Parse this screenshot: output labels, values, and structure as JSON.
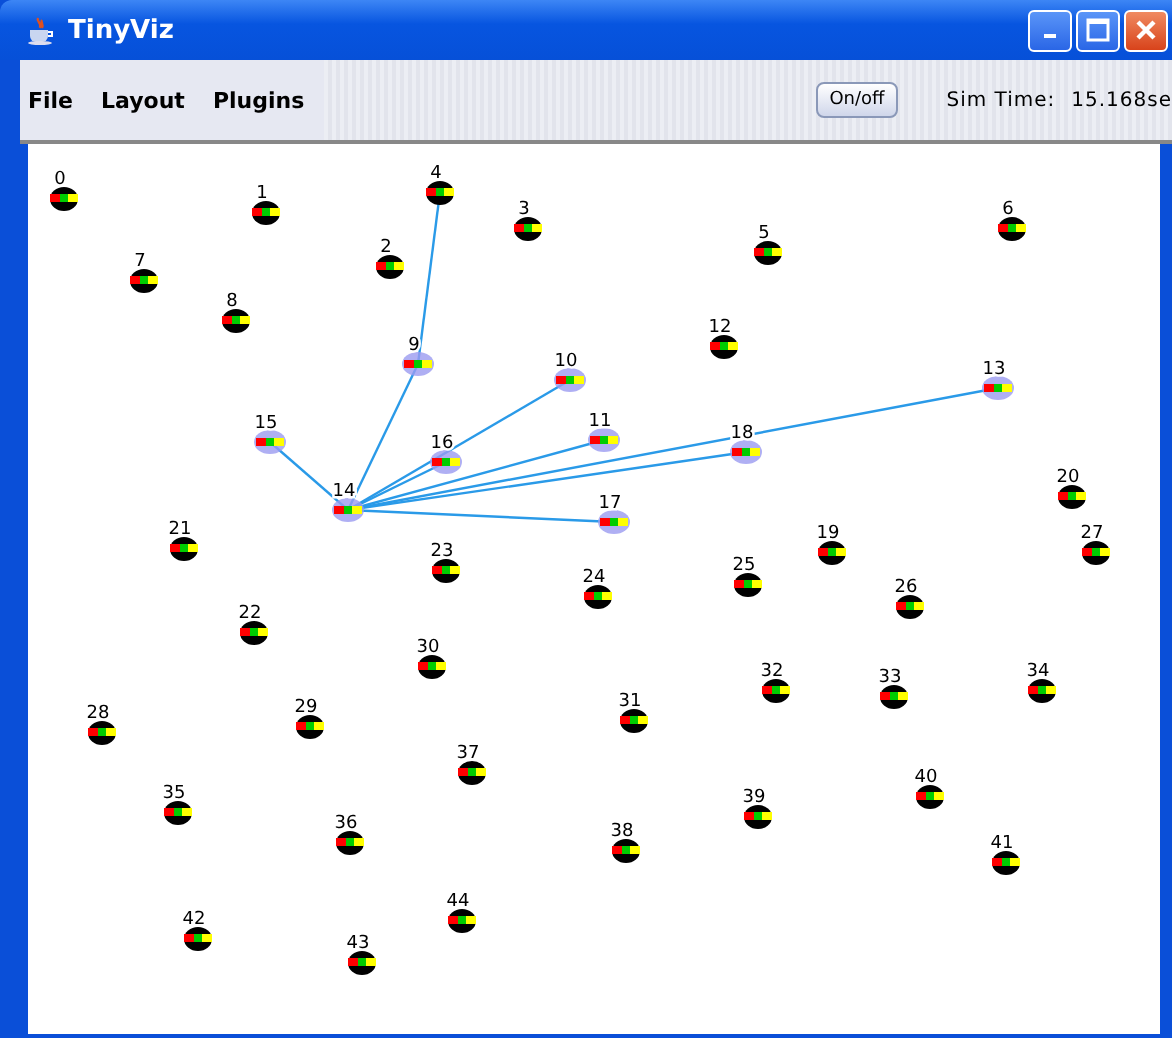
{
  "window": {
    "title": "TinyViz"
  },
  "menu": [
    "File",
    "Layout",
    "Plugins"
  ],
  "toolbar": {
    "button": "On/off",
    "sim_time_label": "Sim Time:",
    "sim_time_value": "15.168se"
  },
  "nodes": [
    {
      "label": "0",
      "selected": false
    },
    {
      "label": "1",
      "selected": false
    },
    {
      "label": "2",
      "selected": false
    },
    {
      "label": "3",
      "selected": false
    },
    {
      "label": "5",
      "selected": false
    },
    {
      "label": "6",
      "selected": false
    },
    {
      "label": "7",
      "selected": false
    },
    {
      "label": "8",
      "selected": false
    },
    {
      "label": "12",
      "selected": false
    },
    {
      "label": "14",
      "selected": true,
      "children": [
        {
          "label": "9",
          "selected": true,
          "children": [
            {
              "label": "4",
              "selected": false
            }
          ]
        },
        {
          "label": "10",
          "selected": true
        },
        {
          "label": "11",
          "selected": true
        },
        {
          "label": "13",
          "selected": true
        },
        {
          "label": "15",
          "selected": true
        },
        {
          "label": "16",
          "selected": true
        },
        {
          "label": "17",
          "selected": true
        },
        {
          "label": "18",
          "selected": true
        }
      ]
    },
    {
      "label": "19",
      "selected": false
    },
    {
      "label": "20",
      "selected": false
    },
    {
      "label": "21",
      "selected": false
    },
    {
      "label": "22",
      "selected": false
    },
    {
      "label": "23",
      "selected": false
    },
    {
      "label": "24",
      "selected": false
    },
    {
      "label": "25",
      "selected": false
    },
    {
      "label": "26",
      "selected": false
    },
    {
      "label": "27",
      "selected": false
    },
    {
      "label": "28",
      "selected": false
    },
    {
      "label": "29",
      "selected": false
    },
    {
      "label": "30",
      "selected": false
    },
    {
      "label": "31",
      "selected": false
    },
    {
      "label": "32",
      "selected": false
    },
    {
      "label": "33",
      "selected": false
    },
    {
      "label": "34",
      "selected": false
    },
    {
      "label": "35",
      "selected": false
    },
    {
      "label": "36",
      "selected": false
    },
    {
      "label": "37",
      "selected": false
    },
    {
      "label": "38",
      "selected": false
    },
    {
      "label": "39",
      "selected": false
    },
    {
      "label": "40",
      "selected": false
    },
    {
      "label": "41",
      "selected": false
    },
    {
      "label": "42",
      "selected": false
    },
    {
      "label": "43",
      "selected": false
    },
    {
      "label": "44",
      "selected": false
    }
  ]
}
